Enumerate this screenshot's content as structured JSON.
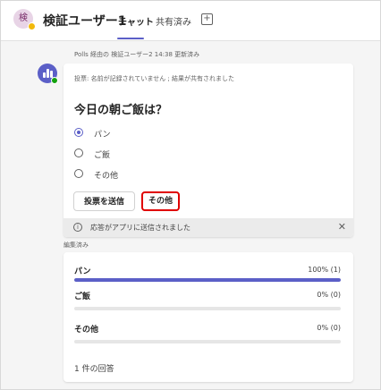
{
  "header": {
    "avatar_initial": "検",
    "title": "検証ユーザー1",
    "tabs": [
      {
        "label": "チャット"
      },
      {
        "label": "共有済み"
      }
    ],
    "add_tab_glyph": "+"
  },
  "message": {
    "meta": "Polls 経由の 検証ユーザー2   14:38   更新済み",
    "note": "投票: 名前が記録されていません ; 結果が共有されました",
    "question": "今日の朝ご飯は？",
    "options": [
      {
        "label": "パン",
        "selected": true
      },
      {
        "label": "ご飯",
        "selected": false
      },
      {
        "label": "その他",
        "selected": false
      }
    ],
    "submit_label": "投票を送信",
    "other_label": "その他",
    "info_text": "応答がアプリに送信されました",
    "info_glyph": "i",
    "dismiss_glyph": "✕"
  },
  "edited_label": "編集済み",
  "results": {
    "items": [
      {
        "label": "パン",
        "value": "100% (1)",
        "fraction": 1.0
      },
      {
        "label": "ご飯",
        "value": "0% (0)",
        "fraction": 0.0
      },
      {
        "label": "その他",
        "value": "0% (0)",
        "fraction": 0.0
      }
    ],
    "count_text": "1 件の回答"
  },
  "colors": {
    "accent": "#5b5fc7",
    "highlight": "#e00000",
    "presence": "#f2b90c",
    "online": "#13a10e"
  }
}
